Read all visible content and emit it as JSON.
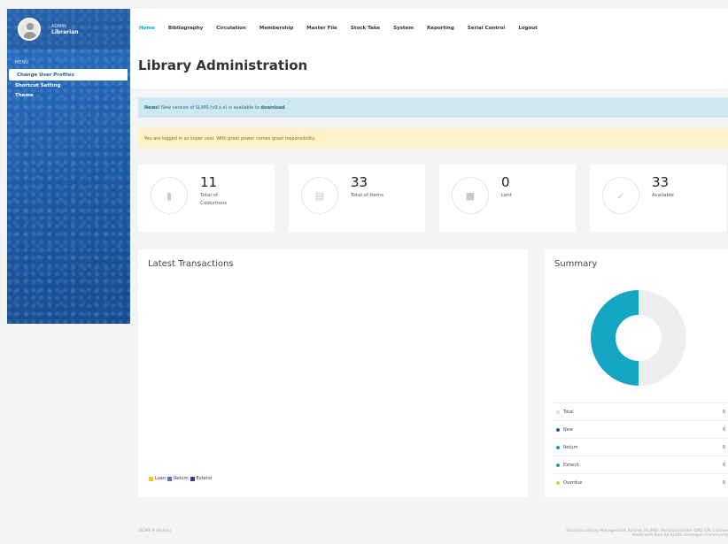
{
  "sidebar": {
    "profile_role": "ADMIN",
    "profile_name": "Librarian",
    "menu_caption": "MENU",
    "items": [
      {
        "label": "Change User Profiles",
        "active": true
      },
      {
        "label": "Shortcut Setting",
        "active": false
      },
      {
        "label": "Theme",
        "active": false
      }
    ]
  },
  "topnav": {
    "items": [
      "Home",
      "Bibliography",
      "Circulation",
      "Membership",
      "Master File",
      "Stock Take",
      "System",
      "Reporting",
      "Serial Control",
      "Logout"
    ],
    "active_index": 0,
    "active_color": "#14a6c4"
  },
  "page_title": "Library Administration",
  "alerts": {
    "info_strong": "News!",
    "info_text": "New version of SLiMS (v9.x.x) is available to ",
    "info_link": "download",
    "warning_text": "You are logged in as super user. With great power comes great responsibility."
  },
  "stats": [
    {
      "value": "11",
      "label": "Total of Collections",
      "icon": "book-icon",
      "glyph": "▮"
    },
    {
      "value": "33",
      "label": "Total of Items",
      "icon": "barcode-icon",
      "glyph": "▤"
    },
    {
      "value": "0",
      "label": "Lent",
      "icon": "archive-icon",
      "glyph": "■"
    },
    {
      "value": "33",
      "label": "Available",
      "icon": "check-icon",
      "glyph": "✓"
    }
  ],
  "transactions": {
    "title": "Latest Transactions",
    "legend": [
      {
        "label": "Loan",
        "color": "#f2c337"
      },
      {
        "label": "Return",
        "color": "#3f7fd0"
      },
      {
        "label": "Extend",
        "color": "#2f3f9e"
      }
    ]
  },
  "summary": {
    "title": "Summary",
    "chart_data": {
      "type": "pie",
      "categories": [
        "New",
        "Return"
      ],
      "values": [
        50,
        50
      ],
      "colors": [
        "#eeeeee",
        "#14a6c4"
      ],
      "title": "Summary"
    },
    "rows": [
      {
        "label": "Total",
        "count": "0",
        "color": "#dddddd"
      },
      {
        "label": "New",
        "count": "0",
        "color": "#1f5fae"
      },
      {
        "label": "Return",
        "count": "0",
        "color": "#14a6c4"
      },
      {
        "label": "Extend",
        "count": "0",
        "color": "#27a0a8"
      },
      {
        "label": "Overdue",
        "count": "0",
        "color": "#f2c337"
      }
    ]
  },
  "footer": {
    "left": "SLiMS 9 (Bulian)",
    "right_line1": "Senayan Library Management System (SLiMS). Released Under GNU GPL License",
    "right_line2": "Made with love by SLiMS Developer Community"
  }
}
